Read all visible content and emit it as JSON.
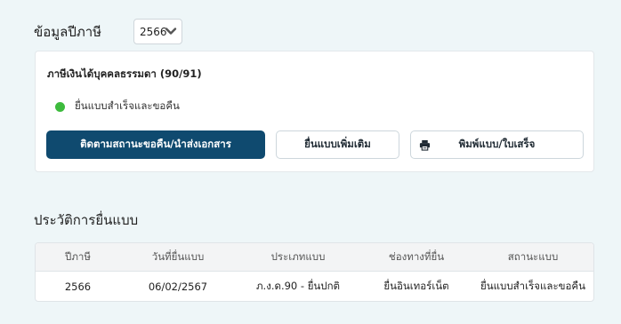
{
  "tax_info": {
    "title": "ข้อมูลปีภาษี",
    "year_select": {
      "selected": "2566"
    }
  },
  "card": {
    "title": "ภาษีเงินได้บุคคลธรรมดา (90/91)",
    "status": {
      "text": "ยื่นแบบสำเร็จและขอคืน",
      "color": "#3dbb3d"
    },
    "buttons": {
      "track": "ติดตามสถานะขอคืน/นำส่งเอกสาร",
      "additional": "ยื่นแบบเพิ่มเติม",
      "print": "พิมพ์แบบ/ใบเสร็จ"
    },
    "print_icon": "printer-icon"
  },
  "history": {
    "title": "ประวัติการยื่นแบบ",
    "columns": [
      "ปีภาษี",
      "วันที่ยื่นแบบ",
      "ประเภทแบบ",
      "ช่องทางที่ยื่น",
      "สถานะแบบ"
    ],
    "rows": [
      [
        "2566",
        "06/02/2567",
        "ภ.ง.ด.90 - ยื่นปกติ",
        "ยื่นอินเทอร์เน็ต",
        "ยื่นแบบสำเร็จและขอคืน"
      ]
    ]
  },
  "colors": {
    "primary": "#0f4a6f",
    "background": "#eef6f8",
    "success": "#3dbb3d"
  }
}
